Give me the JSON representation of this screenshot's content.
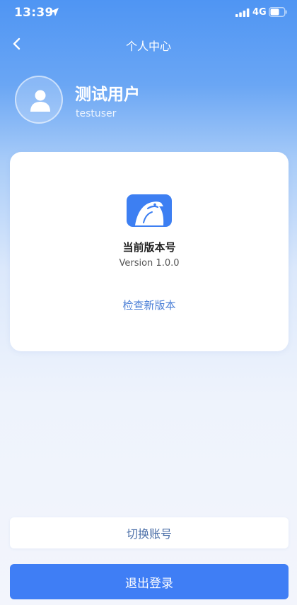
{
  "status_bar": {
    "time": "13:39",
    "network": "4G",
    "location_icon": "location-arrow-icon",
    "signal_icon": "signal-bars-icon",
    "battery_icon": "battery-icon"
  },
  "nav": {
    "title": "个人中心",
    "back_icon": "chevron-left-icon"
  },
  "profile": {
    "name": "测试用户",
    "username": "testuser",
    "avatar_icon": "user-icon"
  },
  "version_card": {
    "logo_icon": "eagle-logo-icon",
    "title": "当前版本号",
    "version": "Version 1.0.0",
    "check_label": "检查新版本"
  },
  "actions": {
    "switch_account": "切换账号",
    "logout": "退出登录"
  },
  "colors": {
    "primary": "#3f7ef5",
    "link": "#4b7fd6",
    "header_top": "#4f95f3"
  }
}
